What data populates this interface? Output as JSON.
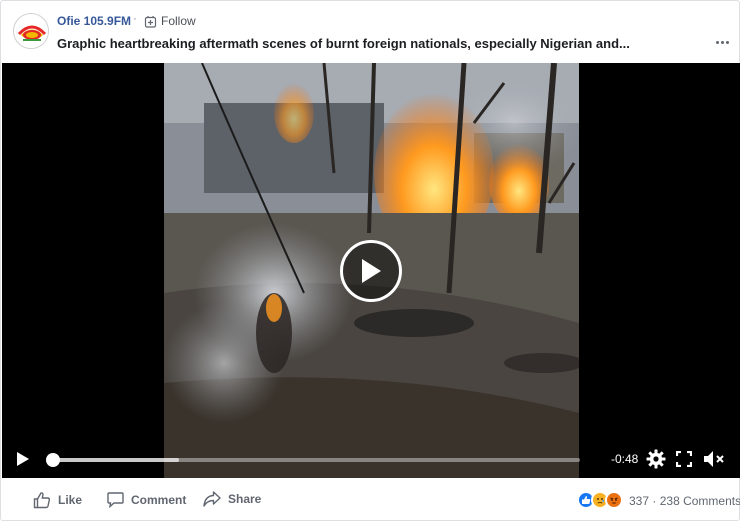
{
  "post": {
    "page_name": "Ofie 105.9FM",
    "separator": "·",
    "follow_label": "Follow",
    "title": "Graphic heartbreaking aftermath scenes of burnt foreign nationals, especially Nigerian and..."
  },
  "video": {
    "time_remaining": "-0:48",
    "progress_fraction": 0.0,
    "buffered_fraction": 0.24
  },
  "actions": {
    "like_label": "Like",
    "comment_label": "Comment",
    "share_label": "Share"
  },
  "stats": {
    "reaction_icons": [
      "like-reaction",
      "sad-reaction",
      "angry-reaction"
    ],
    "reaction_count": "337",
    "dot": "·",
    "comments": "238 Comments"
  },
  "colors": {
    "link": "#365899",
    "like_blue": "#1877f2",
    "sad_yellow": "#f7b125",
    "angry_red": "#e9710f"
  }
}
